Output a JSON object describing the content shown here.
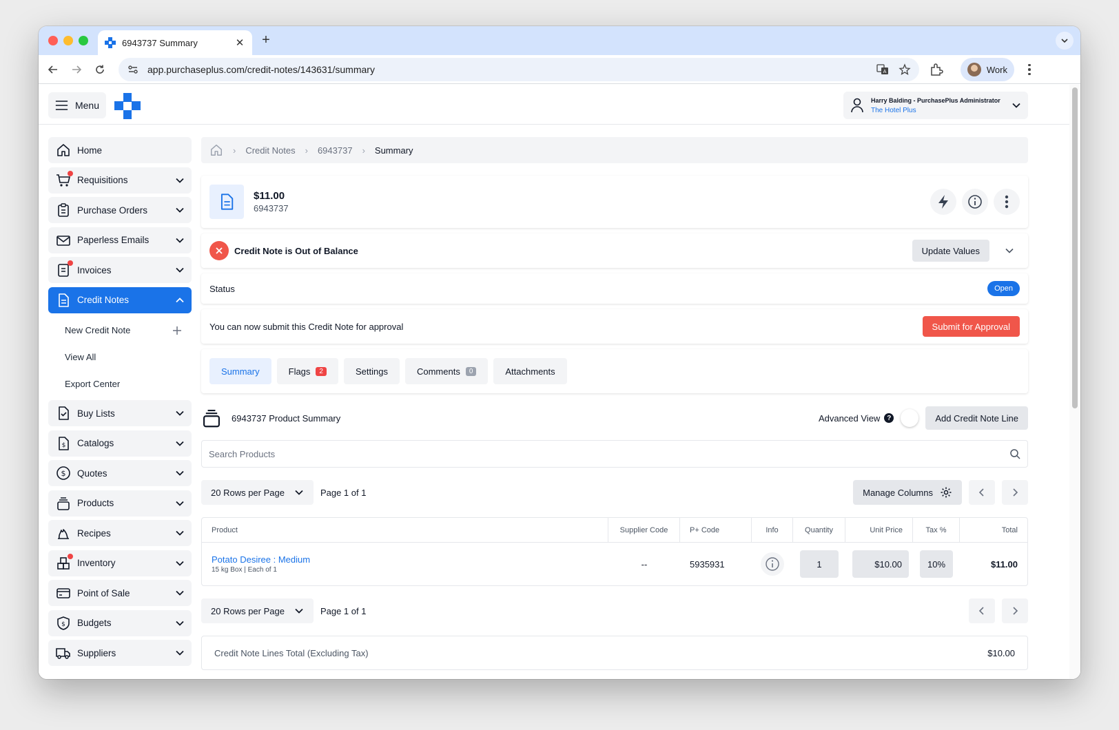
{
  "browser": {
    "tab_title": "6943737 Summary",
    "url": "app.purchaseplus.com/credit-notes/143631/summary",
    "profile": "Work"
  },
  "header": {
    "menu_label": "Menu",
    "user_name": "Harry Balding - PurchasePlus Administrator",
    "user_org": "The Hotel Plus"
  },
  "sidebar": {
    "items": [
      {
        "label": "Home"
      },
      {
        "label": "Requisitions"
      },
      {
        "label": "Purchase Orders"
      },
      {
        "label": "Paperless Emails"
      },
      {
        "label": "Invoices"
      },
      {
        "label": "Credit Notes"
      },
      {
        "label": "Buy Lists"
      },
      {
        "label": "Catalogs"
      },
      {
        "label": "Quotes"
      },
      {
        "label": "Products"
      },
      {
        "label": "Recipes"
      },
      {
        "label": "Inventory"
      },
      {
        "label": "Point of Sale"
      },
      {
        "label": "Budgets"
      },
      {
        "label": "Suppliers"
      }
    ],
    "sub_items": [
      {
        "label": "New Credit Note"
      },
      {
        "label": "View All"
      },
      {
        "label": "Export Center"
      }
    ]
  },
  "breadcrumb": {
    "items": [
      "Credit Notes",
      "6943737",
      "Summary"
    ]
  },
  "summary": {
    "amount": "$11.00",
    "number": "6943737"
  },
  "alert": {
    "text": "Credit Note is Out of Balance",
    "button": "Update Values"
  },
  "status": {
    "label": "Status",
    "value": "Open"
  },
  "submit": {
    "text": "You can now submit this Credit Note for approval",
    "button": "Submit for Approval"
  },
  "tabs": [
    {
      "label": "Summary"
    },
    {
      "label": "Flags",
      "count": "2"
    },
    {
      "label": "Settings"
    },
    {
      "label": "Comments",
      "count": "0"
    },
    {
      "label": "Attachments"
    }
  ],
  "product_summary": {
    "title": "6943737 Product Summary",
    "advanced_view": "Advanced View",
    "add_button": "Add Credit Note Line",
    "search_placeholder": "Search Products",
    "rows_per_page": "20 Rows per Page",
    "page_label": "Page 1 of 1",
    "manage_columns": "Manage Columns"
  },
  "table": {
    "columns": [
      "Product",
      "Supplier Code",
      "P+ Code",
      "Info",
      "Quantity",
      "Unit Price",
      "Tax %",
      "Total"
    ],
    "rows": [
      {
        "product": "Potato Desiree : Medium",
        "product_sub": "15 kg Box | Each of 1",
        "supplier_code": "--",
        "p_code": "5935931",
        "quantity": "1",
        "unit_price": "$10.00",
        "tax": "10%",
        "total": "$11.00"
      }
    ]
  },
  "totals": {
    "label": "Credit Note Lines Total (Excluding Tax)",
    "value": "$10.00"
  },
  "colors": {
    "accent": "#1a73e8",
    "danger": "#f0564a"
  }
}
